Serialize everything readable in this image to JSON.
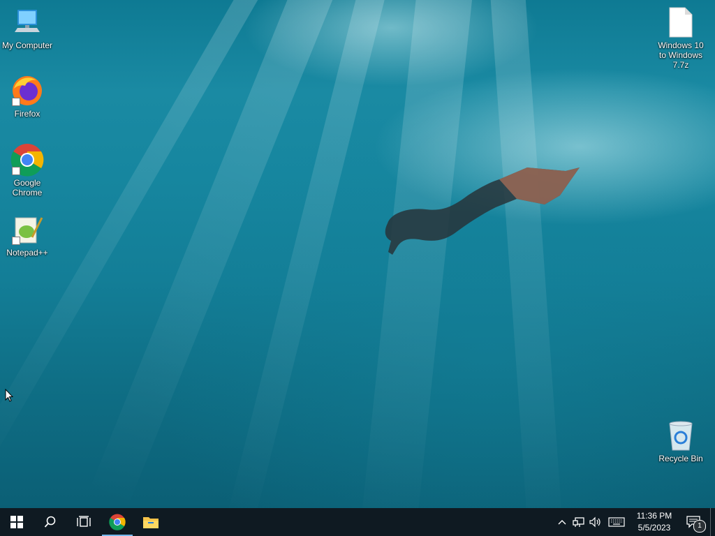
{
  "desktop": {
    "icons": [
      {
        "id": "my-computer",
        "label": "My Computer"
      },
      {
        "id": "firefox",
        "label": "Firefox"
      },
      {
        "id": "chrome",
        "label": "Google Chrome"
      },
      {
        "id": "notepadpp",
        "label": "Notepad++"
      },
      {
        "id": "archive",
        "label": "Windows 10 to Windows 7.7z"
      },
      {
        "id": "recycle-bin",
        "label": "Recycle Bin"
      }
    ]
  },
  "taskbar": {
    "clock": {
      "time": "11:36 PM",
      "date": "5/5/2023"
    },
    "notification_count": "1",
    "accent_color": "#76b9ed"
  }
}
